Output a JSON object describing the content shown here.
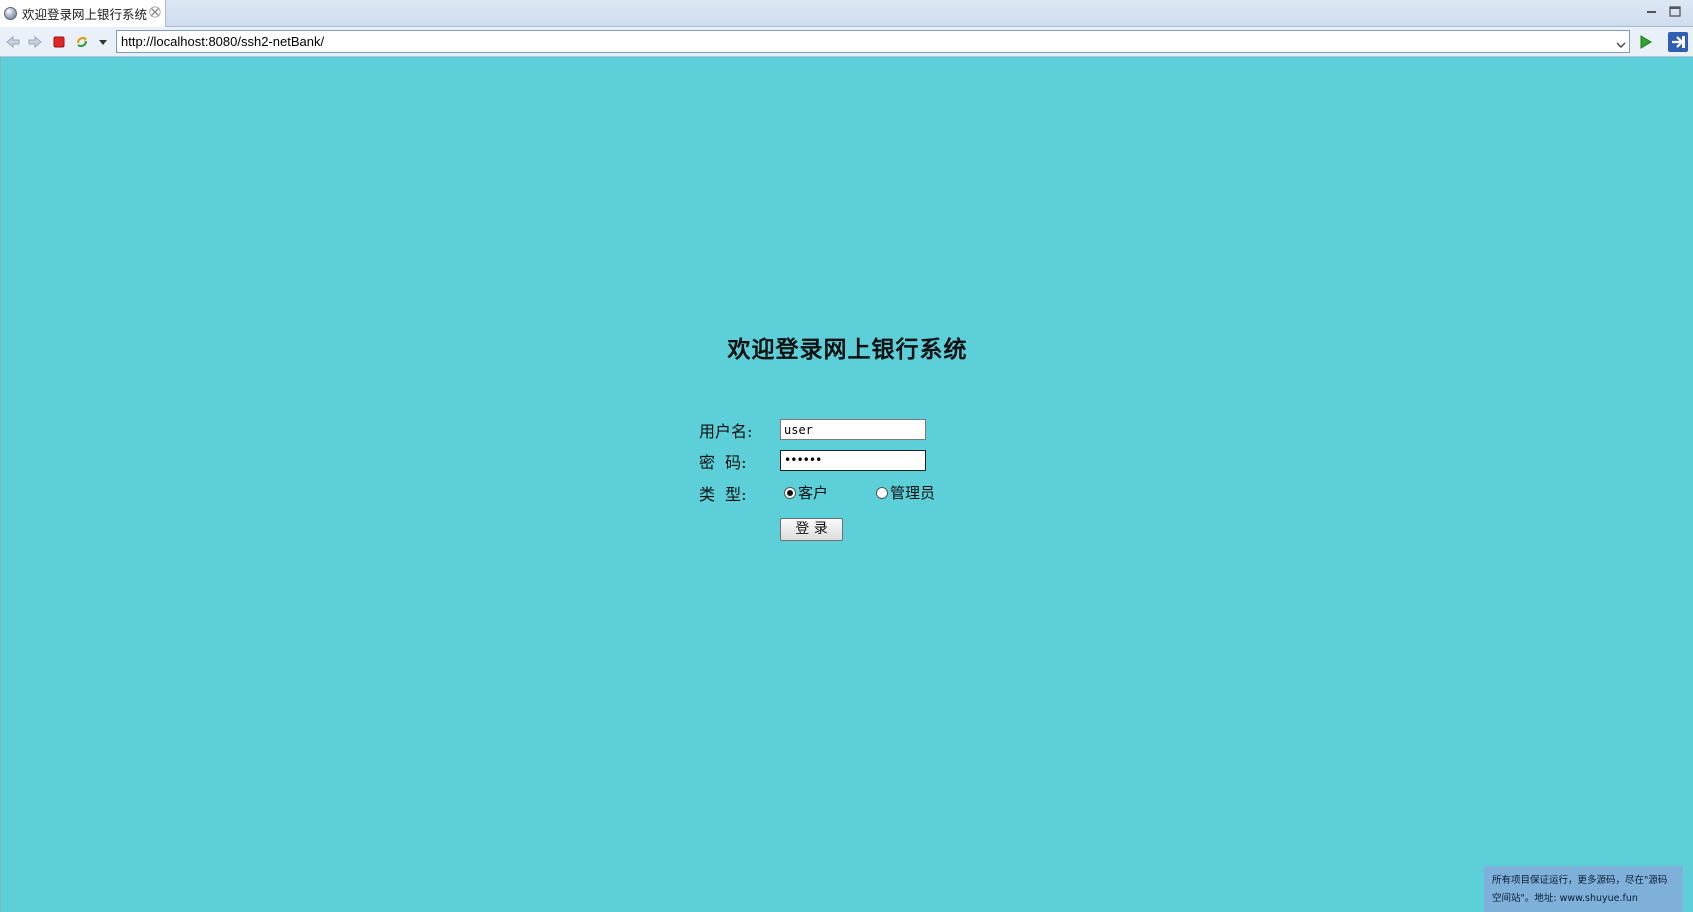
{
  "browser": {
    "tab_title": "欢迎登录网上银行系统",
    "url": "http://localhost:8080/ssh2-netBank/"
  },
  "login": {
    "heading": "欢迎登录网上银行系统",
    "username_label": "用户名:",
    "username_value": "user",
    "password_label": "密  码:",
    "password_masked": "••••••",
    "type_label": "类  型:",
    "type_options": [
      {
        "label": "客户",
        "checked": true
      },
      {
        "label": "管理员",
        "checked": false
      }
    ],
    "submit_label": "登 录"
  },
  "watermark": {
    "line1": "所有项目保证运行，更多源码，尽在\"源码",
    "line2": "空间站\"。地址: www.shuyue.fun"
  },
  "colors": {
    "page_background": "#5ccfd8",
    "watermark_background": "#7fb0d9"
  }
}
